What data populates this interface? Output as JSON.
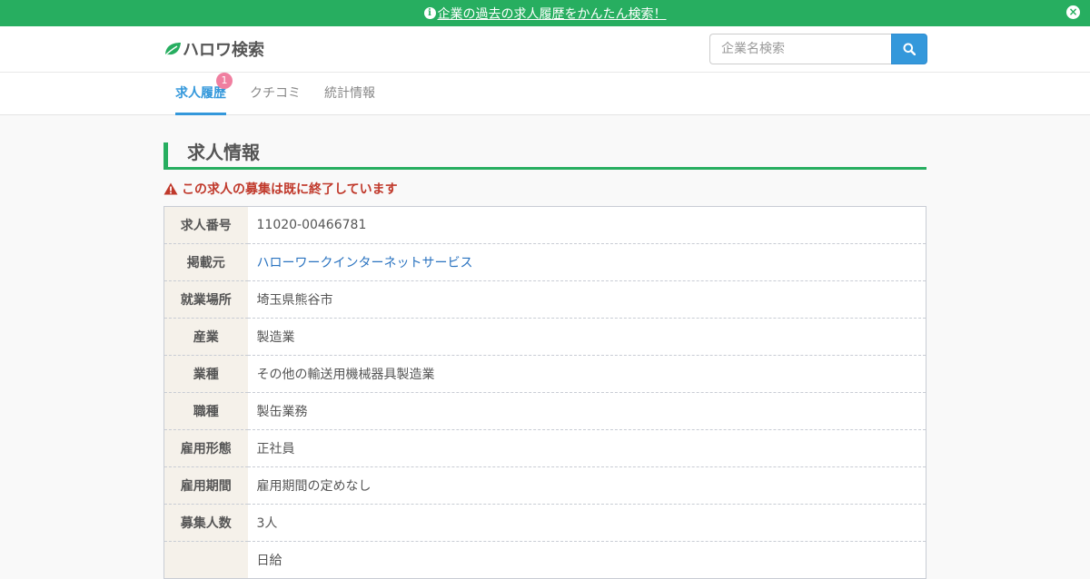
{
  "banner": {
    "info_icon": "i",
    "link_text": "企業の過去の求人履歴をかんたん検索！",
    "close_icon": "×"
  },
  "header": {
    "logo_text": "ハロワ検索",
    "search_placeholder": "企業名検索"
  },
  "tabs": [
    {
      "label": "求人履歴",
      "badge": "1"
    },
    {
      "label": "クチコミ"
    },
    {
      "label": "統計情報"
    }
  ],
  "section": {
    "title": "求人情報",
    "alert": "この求人の募集は既に終了しています"
  },
  "rows": [
    {
      "label": "求人番号",
      "value": "11020-00466781"
    },
    {
      "label": "掲載元",
      "value": "ハローワークインターネットサービス"
    },
    {
      "label": "就業場所",
      "value": "埼玉県熊谷市"
    },
    {
      "label": "産業",
      "value": "製造業"
    },
    {
      "label": "業種",
      "value": "その他の輸送用機械器具製造業"
    },
    {
      "label": "職種",
      "value": "製缶業務"
    },
    {
      "label": "雇用形態",
      "value": "正社員"
    },
    {
      "label": "雇用期間",
      "value": "雇用期間の定めなし"
    },
    {
      "label": "募集人数",
      "value": "3人"
    },
    {
      "label": "",
      "value": "日給"
    }
  ],
  "colors": {
    "brand_green": "#27ae60",
    "accent_blue": "#3498db",
    "alert_red": "#c0392b",
    "badge_pink": "#f07fa0"
  }
}
